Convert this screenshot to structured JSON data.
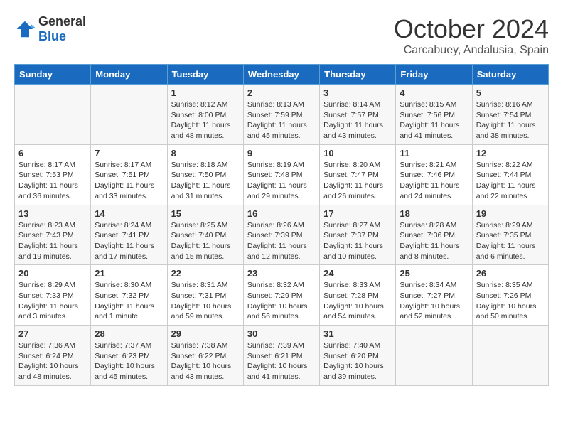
{
  "logo": {
    "general": "General",
    "blue": "Blue"
  },
  "title": "October 2024",
  "location": "Carcabuey, Andalusia, Spain",
  "headers": [
    "Sunday",
    "Monday",
    "Tuesday",
    "Wednesday",
    "Thursday",
    "Friday",
    "Saturday"
  ],
  "weeks": [
    [
      {
        "day": "",
        "info": ""
      },
      {
        "day": "",
        "info": ""
      },
      {
        "day": "1",
        "info": "Sunrise: 8:12 AM\nSunset: 8:00 PM\nDaylight: 11 hours and 48 minutes."
      },
      {
        "day": "2",
        "info": "Sunrise: 8:13 AM\nSunset: 7:59 PM\nDaylight: 11 hours and 45 minutes."
      },
      {
        "day": "3",
        "info": "Sunrise: 8:14 AM\nSunset: 7:57 PM\nDaylight: 11 hours and 43 minutes."
      },
      {
        "day": "4",
        "info": "Sunrise: 8:15 AM\nSunset: 7:56 PM\nDaylight: 11 hours and 41 minutes."
      },
      {
        "day": "5",
        "info": "Sunrise: 8:16 AM\nSunset: 7:54 PM\nDaylight: 11 hours and 38 minutes."
      }
    ],
    [
      {
        "day": "6",
        "info": "Sunrise: 8:17 AM\nSunset: 7:53 PM\nDaylight: 11 hours and 36 minutes."
      },
      {
        "day": "7",
        "info": "Sunrise: 8:17 AM\nSunset: 7:51 PM\nDaylight: 11 hours and 33 minutes."
      },
      {
        "day": "8",
        "info": "Sunrise: 8:18 AM\nSunset: 7:50 PM\nDaylight: 11 hours and 31 minutes."
      },
      {
        "day": "9",
        "info": "Sunrise: 8:19 AM\nSunset: 7:48 PM\nDaylight: 11 hours and 29 minutes."
      },
      {
        "day": "10",
        "info": "Sunrise: 8:20 AM\nSunset: 7:47 PM\nDaylight: 11 hours and 26 minutes."
      },
      {
        "day": "11",
        "info": "Sunrise: 8:21 AM\nSunset: 7:46 PM\nDaylight: 11 hours and 24 minutes."
      },
      {
        "day": "12",
        "info": "Sunrise: 8:22 AM\nSunset: 7:44 PM\nDaylight: 11 hours and 22 minutes."
      }
    ],
    [
      {
        "day": "13",
        "info": "Sunrise: 8:23 AM\nSunset: 7:43 PM\nDaylight: 11 hours and 19 minutes."
      },
      {
        "day": "14",
        "info": "Sunrise: 8:24 AM\nSunset: 7:41 PM\nDaylight: 11 hours and 17 minutes."
      },
      {
        "day": "15",
        "info": "Sunrise: 8:25 AM\nSunset: 7:40 PM\nDaylight: 11 hours and 15 minutes."
      },
      {
        "day": "16",
        "info": "Sunrise: 8:26 AM\nSunset: 7:39 PM\nDaylight: 11 hours and 12 minutes."
      },
      {
        "day": "17",
        "info": "Sunrise: 8:27 AM\nSunset: 7:37 PM\nDaylight: 11 hours and 10 minutes."
      },
      {
        "day": "18",
        "info": "Sunrise: 8:28 AM\nSunset: 7:36 PM\nDaylight: 11 hours and 8 minutes."
      },
      {
        "day": "19",
        "info": "Sunrise: 8:29 AM\nSunset: 7:35 PM\nDaylight: 11 hours and 6 minutes."
      }
    ],
    [
      {
        "day": "20",
        "info": "Sunrise: 8:29 AM\nSunset: 7:33 PM\nDaylight: 11 hours and 3 minutes."
      },
      {
        "day": "21",
        "info": "Sunrise: 8:30 AM\nSunset: 7:32 PM\nDaylight: 11 hours and 1 minute."
      },
      {
        "day": "22",
        "info": "Sunrise: 8:31 AM\nSunset: 7:31 PM\nDaylight: 10 hours and 59 minutes."
      },
      {
        "day": "23",
        "info": "Sunrise: 8:32 AM\nSunset: 7:29 PM\nDaylight: 10 hours and 56 minutes."
      },
      {
        "day": "24",
        "info": "Sunrise: 8:33 AM\nSunset: 7:28 PM\nDaylight: 10 hours and 54 minutes."
      },
      {
        "day": "25",
        "info": "Sunrise: 8:34 AM\nSunset: 7:27 PM\nDaylight: 10 hours and 52 minutes."
      },
      {
        "day": "26",
        "info": "Sunrise: 8:35 AM\nSunset: 7:26 PM\nDaylight: 10 hours and 50 minutes."
      }
    ],
    [
      {
        "day": "27",
        "info": "Sunrise: 7:36 AM\nSunset: 6:24 PM\nDaylight: 10 hours and 48 minutes."
      },
      {
        "day": "28",
        "info": "Sunrise: 7:37 AM\nSunset: 6:23 PM\nDaylight: 10 hours and 45 minutes."
      },
      {
        "day": "29",
        "info": "Sunrise: 7:38 AM\nSunset: 6:22 PM\nDaylight: 10 hours and 43 minutes."
      },
      {
        "day": "30",
        "info": "Sunrise: 7:39 AM\nSunset: 6:21 PM\nDaylight: 10 hours and 41 minutes."
      },
      {
        "day": "31",
        "info": "Sunrise: 7:40 AM\nSunset: 6:20 PM\nDaylight: 10 hours and 39 minutes."
      },
      {
        "day": "",
        "info": ""
      },
      {
        "day": "",
        "info": ""
      }
    ]
  ]
}
